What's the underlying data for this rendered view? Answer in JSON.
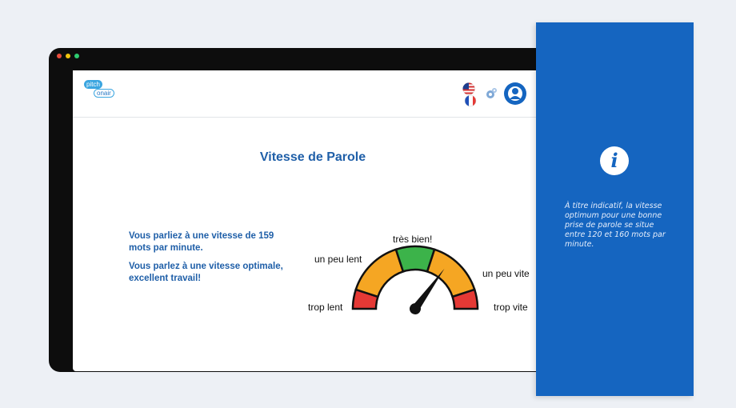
{
  "app": {
    "logo_top": "pitch",
    "logo_bottom": "onair"
  },
  "header": {
    "flag_us": "us-flag-icon",
    "flag_fr": "fr-flag-icon",
    "settings_icon": "gear-icon",
    "profile_icon": "user-avatar-icon"
  },
  "main": {
    "title": "Vitesse de Parole",
    "message_1": "Vous parliez à une vitesse de 159 mots par minute.",
    "message_2": "Vous parlez à une vitesse optimale, excellent travail!"
  },
  "gauge": {
    "labels": {
      "trop_lent": "trop lent",
      "un_peu_lent": "un peu lent",
      "tres_bien": "très bien!",
      "un_peu_vite": "un peu vite",
      "trop_vite": "trop vite"
    },
    "colors": {
      "red": "#e53935",
      "orange": "#f5a623",
      "green": "#3cb34a"
    },
    "needle_level": 0.7
  },
  "info_panel": {
    "icon": "info-icon",
    "text": "À titre indicatif, la vitesse optimum pour une bonne prise de parole se situe entre 120 et 160 mots par minute.",
    "background": "#1565c0"
  }
}
